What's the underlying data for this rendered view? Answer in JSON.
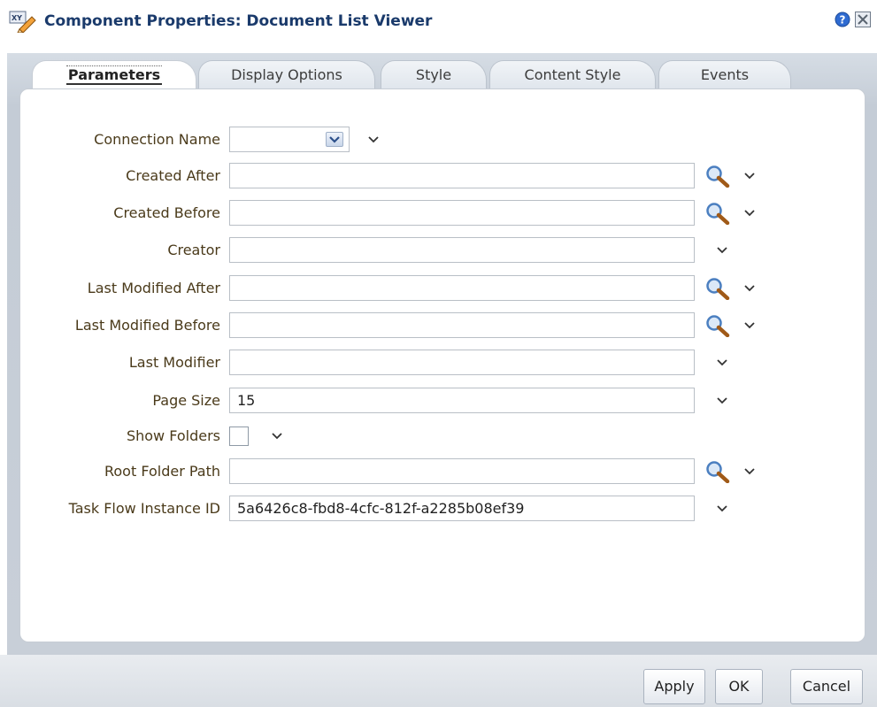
{
  "window": {
    "title": "Component Properties: Document List Viewer",
    "icons": [
      "properties-icon",
      "help-icon",
      "close-icon"
    ]
  },
  "tabs": [
    {
      "label": "Parameters",
      "active": true
    },
    {
      "label": "Display Options",
      "active": false
    },
    {
      "label": "Style",
      "active": false
    },
    {
      "label": "Content Style",
      "active": false
    },
    {
      "label": "Events",
      "active": false
    }
  ],
  "form": {
    "connection_name": {
      "label": "Connection Name",
      "value": ""
    },
    "created_after": {
      "label": "Created After",
      "value": ""
    },
    "created_before": {
      "label": "Created Before",
      "value": ""
    },
    "creator": {
      "label": "Creator",
      "value": ""
    },
    "last_modified_after": {
      "label": "Last Modified After",
      "value": ""
    },
    "last_modified_before": {
      "label": "Last Modified Before",
      "value": ""
    },
    "last_modifier": {
      "label": "Last Modifier",
      "value": ""
    },
    "page_size": {
      "label": "Page Size",
      "value": "15"
    },
    "show_folders": {
      "label": "Show Folders",
      "checked": false
    },
    "root_folder_path": {
      "label": "Root Folder Path",
      "value": ""
    },
    "task_flow_instance_id": {
      "label": "Task Flow Instance ID",
      "value": "5a6426c8-fbd8-4cfc-812f-a2285b08ef39"
    }
  },
  "buttons": {
    "apply": "Apply",
    "ok": "OK",
    "cancel": "Cancel"
  },
  "colors": {
    "title": "#1a3a6b",
    "label": "#4a3a1a",
    "panel": "#c8cfd8"
  }
}
